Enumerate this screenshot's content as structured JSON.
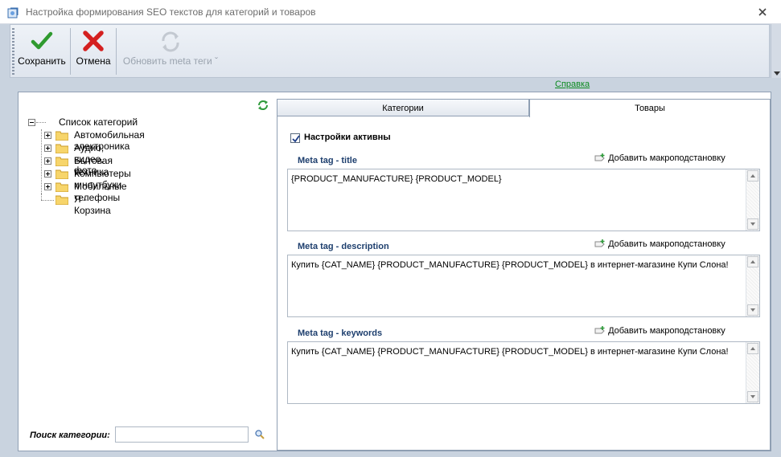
{
  "window": {
    "title": "Настройка формирования SEO текстов для категорий и товаров"
  },
  "toolbar": {
    "save_label": "Сохранить",
    "cancel_label": "Отмена",
    "update_meta_label": "Обновить meta теги"
  },
  "help_link": "Справка",
  "tree": {
    "root": "Список категорий",
    "items": [
      {
        "label": "Автомобильная электроника"
      },
      {
        "label": "Аудио, видео, фото"
      },
      {
        "label": "Бытовая техника"
      },
      {
        "label": "Компьютеры и ноутбуки"
      },
      {
        "label": "Мобильные телефоны"
      },
      {
        "label": "Я - Корзина"
      }
    ]
  },
  "search": {
    "label": "Поиск категории:",
    "value": ""
  },
  "tabs": {
    "categories": "Категории",
    "goods": "Товары"
  },
  "settings": {
    "active_label": "Настройки активны",
    "active_checked": true
  },
  "macro_label": "Добавить макроподстановку",
  "meta": {
    "title": {
      "label": "Meta tag - title",
      "value": "{PRODUCT_MANUFACTURE} {PRODUCT_MODEL}"
    },
    "description": {
      "label": "Meta tag - description",
      "value": "Купить  {CAT_NAME} {PRODUCT_MANUFACTURE} {PRODUCT_MODEL} в интернет-магазине Купи Слона!"
    },
    "keywords": {
      "label": "Meta tag - keywords",
      "value": "Купить  {CAT_NAME} {PRODUCT_MANUFACTURE} {PRODUCT_MODEL} в интернет-магазине Купи Слона!"
    }
  },
  "colors": {
    "accent_link": "#0a8a1f",
    "section_title": "#1e3f6e"
  }
}
